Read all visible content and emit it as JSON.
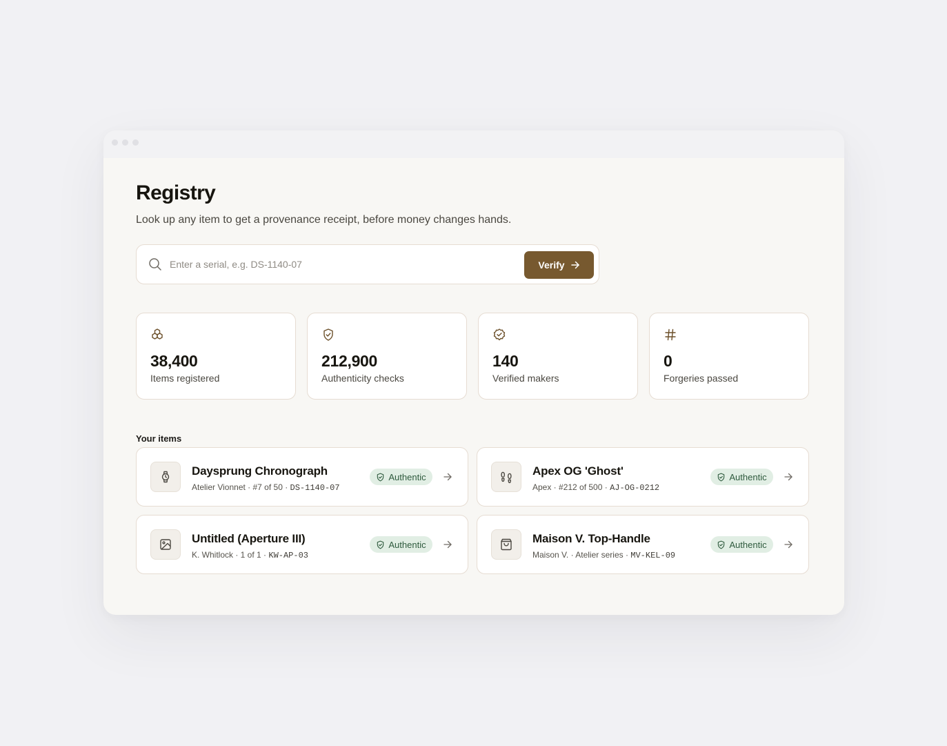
{
  "page": {
    "title": "Registry",
    "subtitle": "Look up any item to get a provenance receipt, before money changes hands."
  },
  "search": {
    "placeholder": "Enter a serial, e.g. DS-1140-07",
    "value": "",
    "button_label": "Verify",
    "button_color": "#77592f"
  },
  "stats": [
    {
      "icon": "cubes-icon",
      "value": "38,400",
      "label": "Items registered"
    },
    {
      "icon": "shield-check-icon",
      "value": "212,900",
      "label": "Authenticity checks"
    },
    {
      "icon": "badge-check-icon",
      "value": "140",
      "label": "Verified makers"
    },
    {
      "icon": "hash-icon",
      "value": "0",
      "label": "Forgeries passed"
    }
  ],
  "items_section": {
    "title": "Your items",
    "items": [
      {
        "icon": "watch-icon",
        "name": "Daysprung Chronograph",
        "maker": "Atelier Vionnet · #7 of 50 · ",
        "serial": "DS-1140-07",
        "status": "Authentic"
      },
      {
        "icon": "footprints-icon",
        "name": "Apex OG 'Ghost'",
        "maker": "Apex · #212 of 500 · ",
        "serial": "AJ-OG-0212",
        "status": "Authentic"
      },
      {
        "icon": "image-icon",
        "name": "Untitled (Aperture III)",
        "maker": "K. Whitlock · 1 of 1 · ",
        "serial": "KW-AP-03",
        "status": "Authentic"
      },
      {
        "icon": "bag-icon",
        "name": "Maison V. Top-Handle",
        "maker": "Maison V. · Atelier series · ",
        "serial": "MV-KEL-09",
        "status": "Authentic"
      }
    ]
  },
  "colors": {
    "accent": "#77592f",
    "status_bg": "#e1eee4",
    "status_text": "#2e5a3d"
  }
}
